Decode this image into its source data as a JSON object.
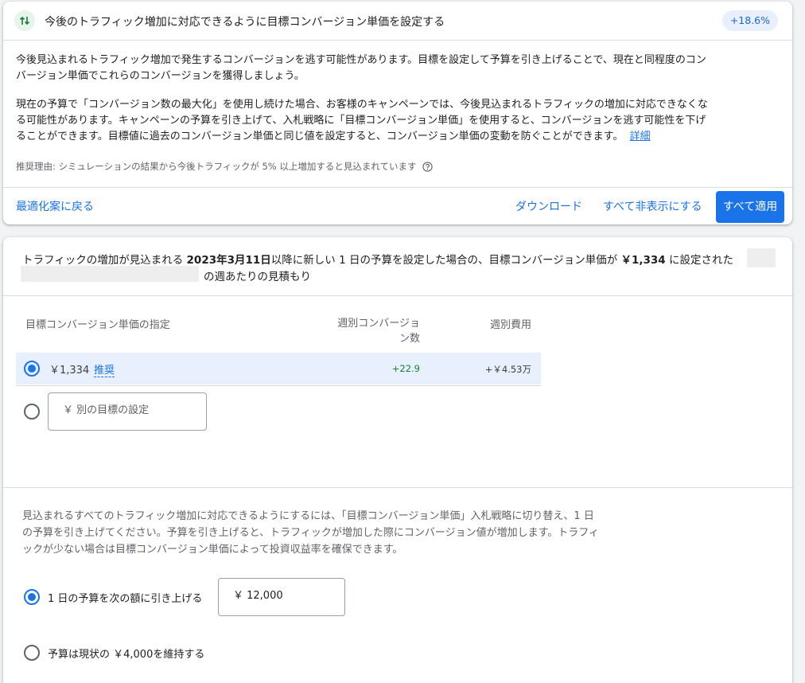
{
  "recommendation": {
    "title": "今後のトラフィック増加に対応できるように目標コンバージョン単価を設定する",
    "badge": "+18.6%",
    "para1": [
      "今後見込まれるトラフィック増加で発生するコンバージョンを逃す可能性があります。目標を設定して予算を引き上げることで、現在と同程度のコン",
      "バージョン単価でこれらのコンバージョンを獲得しましょう。"
    ],
    "para2": [
      "現在の予算で「コンバージョン数の最大化」を使用し続けた場合、お客様のキャンペーンでは、今後見込まれるトラフィックの増加に対応できなくな",
      "る可能性があります。キャンペーンの予算を引き上げて、入札戦略に「目標コンバージョン単価」を使用すると、コンバージョンを逃す可能性を下げ",
      "ることができます。目標値に過去のコンバージョン単価と同じ値を設定すると、コンバージョン単価の変動を防ぐことができます。"
    ],
    "details_link": "詳細",
    "reason": "推奨理由: シミュレーションの結果から今後トラフィックが 5% 以上増加すると見込まれています",
    "back_link": "最適化案に戻る",
    "download": "ダウンロード",
    "hide_all": "すべて非表示にする",
    "apply_all": "すべて適用"
  },
  "estimate": {
    "prefix": "トラフィックの増加が見込まれる ",
    "date": "2023年3月11日",
    "middle": "以降に新しい 1 日の予算を設定した場合の、目標コンバージョン単価が ",
    "amount": "￥1,334",
    "suffix": " に設定された",
    "line2": "の週あたりの見積もり"
  },
  "table": {
    "col1": "目標コンバージョン単価の指定",
    "col2_line1": "週別コンバージョ",
    "col2_line2": "ン数",
    "col3": "週別費用",
    "row1_value": "￥1,334",
    "row1_tag": "推奨",
    "row1_conversions": "+22.9",
    "row1_cost": "+￥4.53万",
    "row2_placeholder": "￥ 別の目標の設定"
  },
  "budget": {
    "info": [
      "見込まれるすべてのトラフィック増加に対応できるようにするには、「目標コンバージョン単価」入札戦略に切り替え、1 日",
      "の予算を引き上げてください。予算を引き上げると、トラフィックが増加した際にコンバージョン値が増加します。トラフィ",
      "ックが少ない場合は目標コンバージョン単価によって投資収益率を確保できます。"
    ],
    "option1_label": "1 日の予算を次の額に引き上げる",
    "option1_value": "￥ 12,000",
    "option2_label": "予算は現状の ￥4,000を維持する"
  },
  "colors": {
    "accent": "#1a73e8",
    "positive": "#188038",
    "highlight_row": "#e8f0fe"
  }
}
